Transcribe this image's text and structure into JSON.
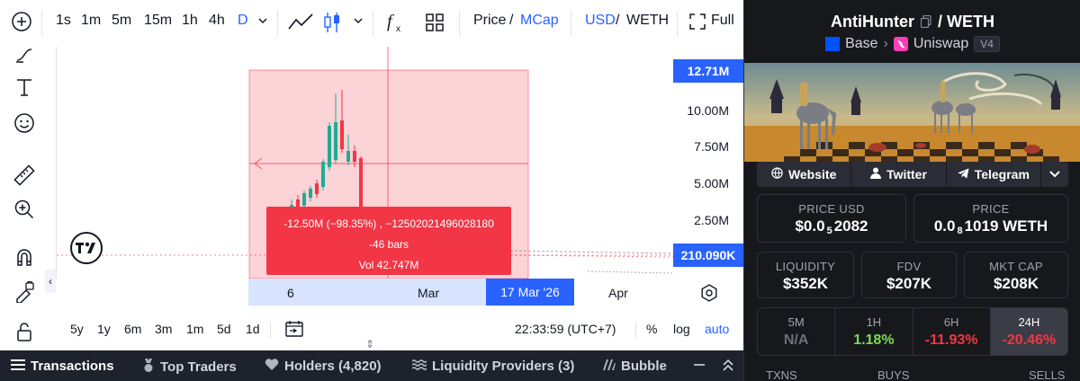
{
  "toolbar": {
    "intervals": [
      "1s",
      "1m",
      "5m",
      "15m",
      "1h",
      "4h",
      "D"
    ],
    "price_label": "Price",
    "slash": "/",
    "mcap_label": "MCap",
    "usd_label": "USD",
    "weth_label": "WETH",
    "full_label": "Full"
  },
  "price_axis": {
    "top_flag": "12.71M",
    "labels": [
      "10.00M",
      "7.50M",
      "5.00M",
      "2.50M"
    ],
    "bottom_flag": "210.090K"
  },
  "time_axis": {
    "labels": [
      "6",
      "Mar",
      "Apr"
    ],
    "cursor_flag": "17 Mar '26"
  },
  "tooltip": {
    "line1": "-12.50M (−98.35%) , −12502021496028180",
    "line2": "-46 bars",
    "line3": "Vol 42.747M"
  },
  "ranges": {
    "items": [
      "5y",
      "1y",
      "6m",
      "3m",
      "1m",
      "5d",
      "1d"
    ],
    "time": "22:33:59 (UTC+7)",
    "percent": "%",
    "log": "log",
    "auto": "auto"
  },
  "tabs": {
    "transactions": "Transactions",
    "top_traders": "Top Traders",
    "holders": "Holders (4,820)",
    "liquidity": "Liquidity Providers (3)",
    "bubble": "Bubble"
  },
  "token": {
    "name": "AntiHunter",
    "quote": "WETH",
    "chain": "Base",
    "dex": "Uniswap",
    "version": "V4"
  },
  "social": {
    "website": "Website",
    "twitter": "Twitter",
    "telegram": "Telegram"
  },
  "stats": {
    "price_usd_label": "PRICE USD",
    "price_usd_prefix": "$0.0",
    "price_usd_sub": "5",
    "price_usd_suffix": "2082",
    "price_label": "PRICE",
    "price_prefix": "0.0",
    "price_sub": "8",
    "price_suffix": "1019 WETH",
    "liquidity_label": "LIQUIDITY",
    "liquidity": "$352K",
    "fdv_label": "FDV",
    "fdv": "$207K",
    "mcap_label": "MKT CAP",
    "mcap": "$208K"
  },
  "performance": [
    {
      "label": "5M",
      "value": "N/A",
      "color": "#6b6f78"
    },
    {
      "label": "1H",
      "value": "1.18%",
      "color": "#7ed957"
    },
    {
      "label": "6H",
      "value": "-11.93%",
      "color": "#f23645"
    },
    {
      "label": "24H",
      "value": "-20.46%",
      "color": "#f23645"
    }
  ],
  "tx_headers": {
    "txns": "TXNS",
    "buys": "BUYS",
    "sells": "SELLS"
  },
  "colors": {
    "accent": "#2962ff",
    "up": "#22ab94",
    "down": "#f23645"
  }
}
